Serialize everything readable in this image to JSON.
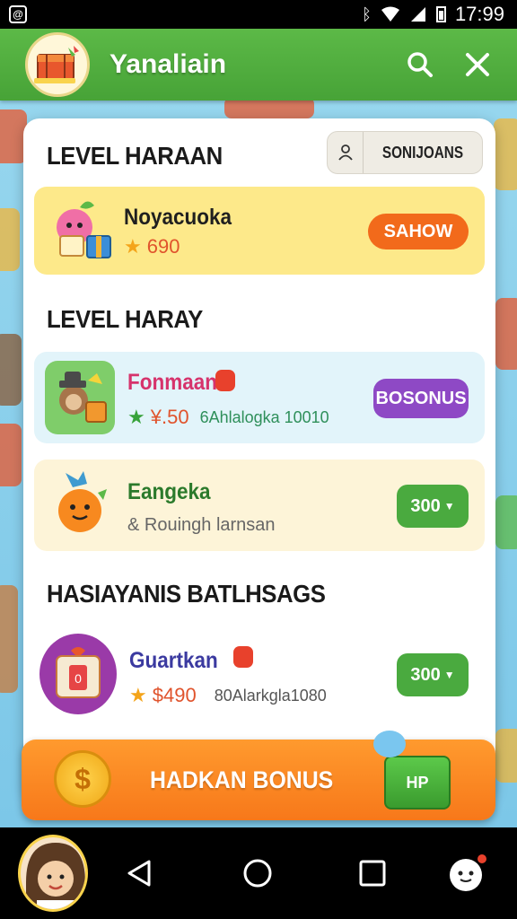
{
  "status_bar": {
    "time": "17:99"
  },
  "app_bar": {
    "title": "Yanaliain",
    "logo_icon": "crate-logo-icon"
  },
  "sections": [
    {
      "title": "LEVEL HARAAN",
      "button": {
        "label": "SONIJOANS"
      },
      "cards": [
        {
          "name": "Noyacuoka",
          "price": "690",
          "action": "SAHOW",
          "action_color": "#f26a1b",
          "bg": "#fde98a"
        }
      ]
    },
    {
      "title": "LEVEL HARAY",
      "cards": [
        {
          "name": "Fonmaan",
          "price": "¥.50",
          "extra": "6Ahlalogka 10010",
          "action": "BOSONUS",
          "action_color": "#8e49c5",
          "bg": "#e2f4fa"
        },
        {
          "name": "Eangeka",
          "subtitle": "& Rouingh larnsan",
          "action": "300",
          "action_color": "#4aaa3f",
          "bg": "#fdf4d8"
        }
      ]
    },
    {
      "title": "HASIAYANIS BATLHSAGS",
      "cards": [
        {
          "name": "Guartkan",
          "price": "$490",
          "extra": "80Alarkgla1080",
          "action": "300",
          "action_color": "#4aaa3f",
          "bg": "#ffffff"
        }
      ]
    }
  ],
  "bonus": {
    "label": "HADKAN BONUS",
    "coin_symbol": "$",
    "box_label": "HP"
  },
  "colors": {
    "app_green": "#4cab3a",
    "bonus_orange": "#f7881f",
    "purple": "#8e49c5",
    "star": "#f4a41a"
  }
}
